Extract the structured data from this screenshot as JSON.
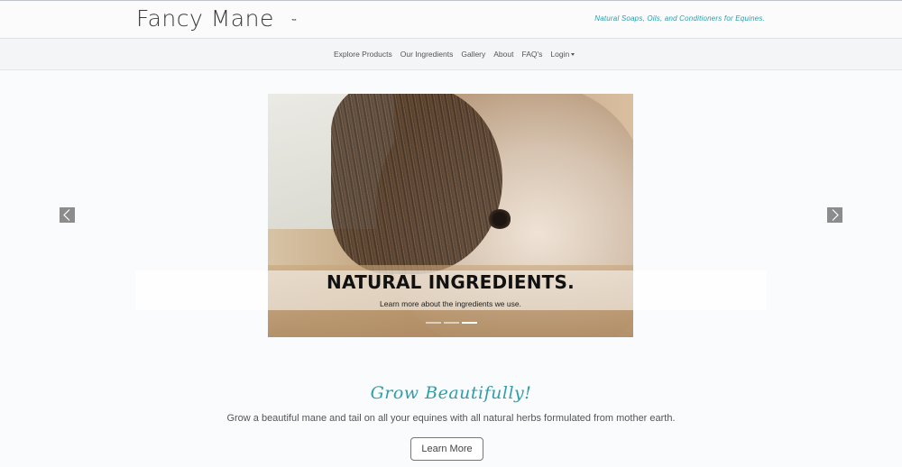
{
  "header": {
    "logo": "Fancy Mane",
    "trademark": "™",
    "tagline": "Natural Soaps, Oils, and Conditioners for Equines."
  },
  "nav": {
    "items": [
      "Explore Products",
      "Our Ingredients",
      "Gallery",
      "About",
      "FAQ's",
      "Login"
    ]
  },
  "carousel": {
    "caption_title": "NATURAL INGREDIENTS.",
    "caption_text": "Learn more about the ingredients we use.",
    "slide_count": 3,
    "active_slide": 3,
    "prev_icon": "chevron-left-icon",
    "next_icon": "chevron-right-icon"
  },
  "intro": {
    "heading": "Grow Beautifully!",
    "text": "Grow a beautiful mane and tail on all your equines with all natural herbs formulated from mother earth.",
    "button": "Learn More"
  },
  "colors": {
    "accent": "#2e9ea8",
    "arrow_bg": "#8c8c8c"
  }
}
